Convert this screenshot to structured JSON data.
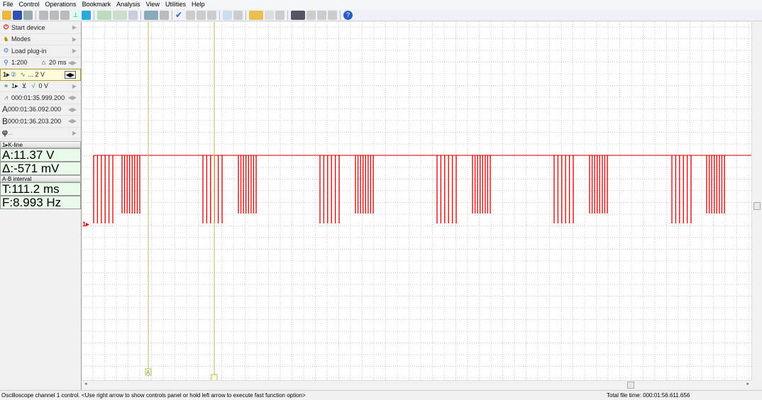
{
  "menu": [
    "File",
    "Control",
    "Operations",
    "Bookmark",
    "Analysis",
    "View",
    "Utilities",
    "Help"
  ],
  "panel": {
    "start_device": "Start device",
    "modes": "Modes",
    "load_plugin": "Load plug-in",
    "zoom": "1:200",
    "timebase": "20 ms",
    "channel": "1▸",
    "channel_scale": "... 2 V",
    "trigger": "1▸",
    "trigger_level": "0 V",
    "trigger_time": "000:01:35.999.200",
    "cursor_a_label": "A",
    "cursor_a": "000:01:36.092.000",
    "cursor_b_label": "B",
    "cursor_b": "000:01:36.203.200",
    "phi_label": "φ",
    "phi": "...",
    "kline_header": "1▸K-line",
    "kline_a": "A:11.37 V",
    "kline_delta": "Δ:-571 mV",
    "ab_header": "A-B interval",
    "ab_t": "T:111.2 ms",
    "ab_f": "F:8.993 Hz"
  },
  "plot": {
    "channel_marker": "1▸",
    "cursor_a": "A",
    "cursor_b": "B",
    "trace_color": "#e00000",
    "cursor_color": "#b8b860"
  },
  "status": {
    "message": "Oscilloscope channel 1 control. <Use right arrow to show controls panel or hold left arrow to execute fast function option>",
    "total_time": "Total file time: 000:01:56.611.656"
  }
}
